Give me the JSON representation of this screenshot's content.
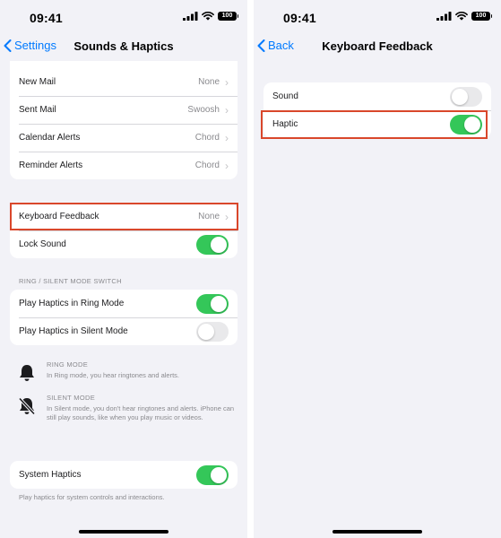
{
  "status_bar": {
    "time": "09:41",
    "battery": "100"
  },
  "left_screen": {
    "back_label": "Settings",
    "title": "Sounds & Haptics",
    "alert_rows": [
      {
        "label": "New Mail",
        "value": "None"
      },
      {
        "label": "Sent Mail",
        "value": "Swoosh"
      },
      {
        "label": "Calendar Alerts",
        "value": "Chord"
      },
      {
        "label": "Reminder Alerts",
        "value": "Chord"
      }
    ],
    "keyboard_feedback": {
      "label": "Keyboard Feedback",
      "value": "None"
    },
    "lock_sound": {
      "label": "Lock Sound",
      "on": true
    },
    "ring_silent_header": "RING / SILENT MODE SWITCH",
    "haptics_ring": {
      "label": "Play Haptics in Ring Mode",
      "on": true
    },
    "haptics_silent": {
      "label": "Play Haptics in Silent Mode",
      "on": false
    },
    "ring_mode": {
      "title": "RING MODE",
      "body": "In Ring mode, you hear ringtones and alerts."
    },
    "silent_mode": {
      "title": "SILENT MODE",
      "body": "In Silent mode, you don't hear ringtones and alerts. iPhone can still play sounds, like when you play music or videos."
    },
    "system_haptics": {
      "label": "System Haptics",
      "on": true
    },
    "system_haptics_footer": "Play haptics for system controls and interactions."
  },
  "right_screen": {
    "back_label": "Back",
    "title": "Keyboard Feedback",
    "sound": {
      "label": "Sound",
      "on": false
    },
    "haptic": {
      "label": "Haptic",
      "on": true
    }
  },
  "colors": {
    "accent": "#007aff",
    "toggle_on": "#34c759",
    "highlight": "#d9472b"
  }
}
